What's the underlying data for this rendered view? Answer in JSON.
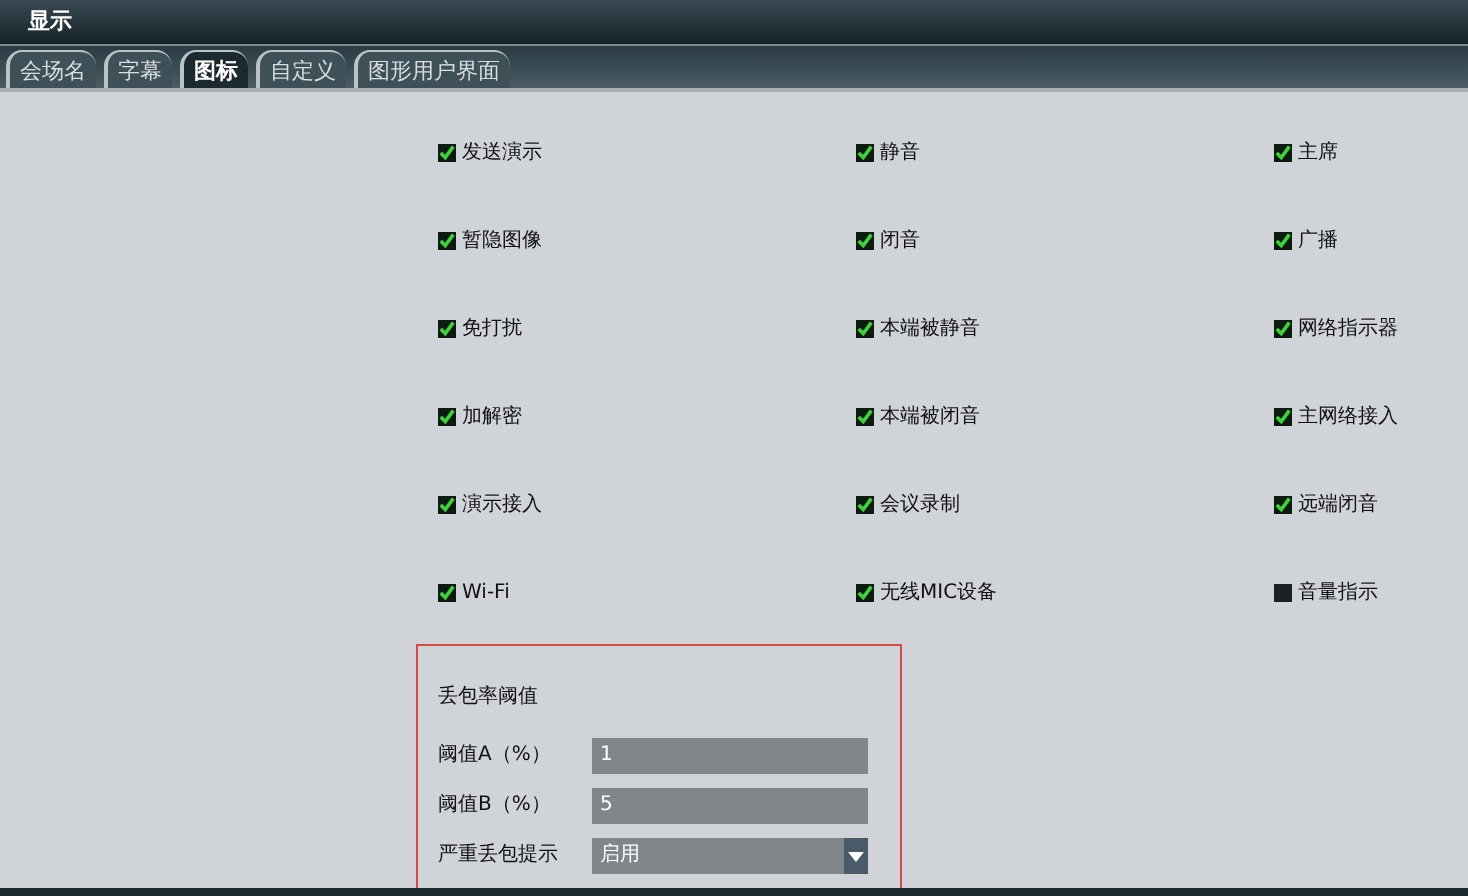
{
  "window": {
    "title": "显示"
  },
  "tabs": [
    {
      "label": "会场名",
      "selected": false
    },
    {
      "label": "字幕",
      "selected": false
    },
    {
      "label": "图标",
      "selected": true
    },
    {
      "label": "自定义",
      "selected": false
    },
    {
      "label": "图形用户界面",
      "selected": false
    }
  ],
  "options": [
    {
      "label": "发送演示",
      "checked": true
    },
    {
      "label": "静音",
      "checked": true
    },
    {
      "label": "主席",
      "checked": true
    },
    {
      "label": "暂隐图像",
      "checked": true
    },
    {
      "label": "闭音",
      "checked": true
    },
    {
      "label": "广播",
      "checked": true
    },
    {
      "label": "免打扰",
      "checked": true
    },
    {
      "label": "本端被静音",
      "checked": true
    },
    {
      "label": "网络指示器",
      "checked": true
    },
    {
      "label": "加解密",
      "checked": true
    },
    {
      "label": "本端被闭音",
      "checked": true
    },
    {
      "label": "主网络接入",
      "checked": true
    },
    {
      "label": "演示接入",
      "checked": true
    },
    {
      "label": "会议录制",
      "checked": true
    },
    {
      "label": "远端闭音",
      "checked": true
    },
    {
      "label": "Wi-Fi",
      "checked": true
    },
    {
      "label": "无线MIC设备",
      "checked": true
    },
    {
      "label": "音量指示",
      "checked": false
    }
  ],
  "packet_loss": {
    "title": "丢包率阈值",
    "fields": [
      {
        "kind": "input",
        "label": "阈值A（%）",
        "value": "1"
      },
      {
        "kind": "input",
        "label": "阈值B（%）",
        "value": "5"
      },
      {
        "kind": "select",
        "label": "严重丢包提示",
        "value": "启用"
      }
    ]
  }
}
